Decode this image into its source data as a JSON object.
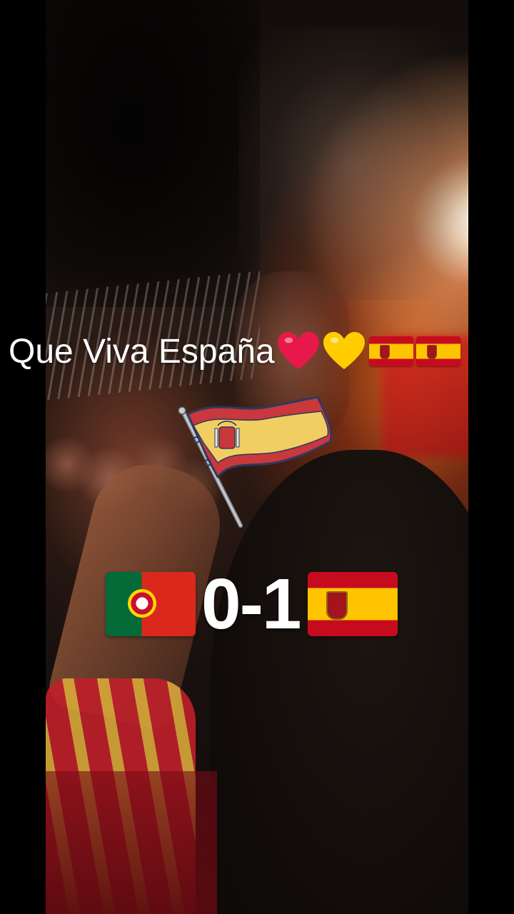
{
  "overlay": {
    "caption": "Que Viva España",
    "caption_emojis": [
      "red-heart-icon",
      "yellow-heart-icon",
      "spain-flag-icon",
      "spain-flag-icon"
    ],
    "score": "0-1",
    "teams": {
      "home_flag": "portugal-flag-icon",
      "away_flag": "spain-flag-icon"
    }
  },
  "colors": {
    "spain_red": "#c60b1e",
    "spain_yellow": "#ffc400",
    "portugal_green": "#046a38",
    "portugal_red": "#da291c",
    "heart_red": "#e8194a",
    "heart_yellow": "#ffcc00"
  }
}
